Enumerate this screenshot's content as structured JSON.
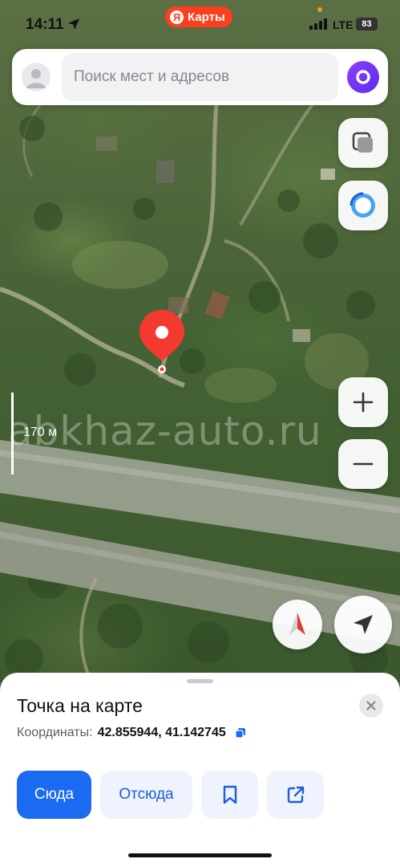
{
  "status_bar": {
    "time": "14:11",
    "app_badge": "Карты",
    "app_badge_logo": "Я",
    "network": "LTE",
    "battery": "83"
  },
  "search": {
    "placeholder": "Поиск мест и адресов"
  },
  "map": {
    "scale_label": "170 м",
    "watermark": "abkhaz-auto.ru"
  },
  "sheet": {
    "title": "Точка на карте",
    "coords_label": "Координаты:",
    "coords_value": "42.855944, 41.142745",
    "actions": {
      "here": "Сюда",
      "from": "Отсюда"
    }
  },
  "colors": {
    "brand_red": "#fc3f1d",
    "primary_blue": "#1a6af2",
    "pin_red": "#f23b2e",
    "alice_purple": "#7b3ff8"
  },
  "icons": [
    "location-arrow-icon",
    "user-avatar-icon",
    "alice-icon",
    "layers-icon",
    "alice-assistant-icon",
    "zoom-in-icon",
    "zoom-out-icon",
    "compass-icon",
    "my-location-icon",
    "close-icon",
    "copy-icon",
    "bookmark-icon",
    "share-icon"
  ]
}
